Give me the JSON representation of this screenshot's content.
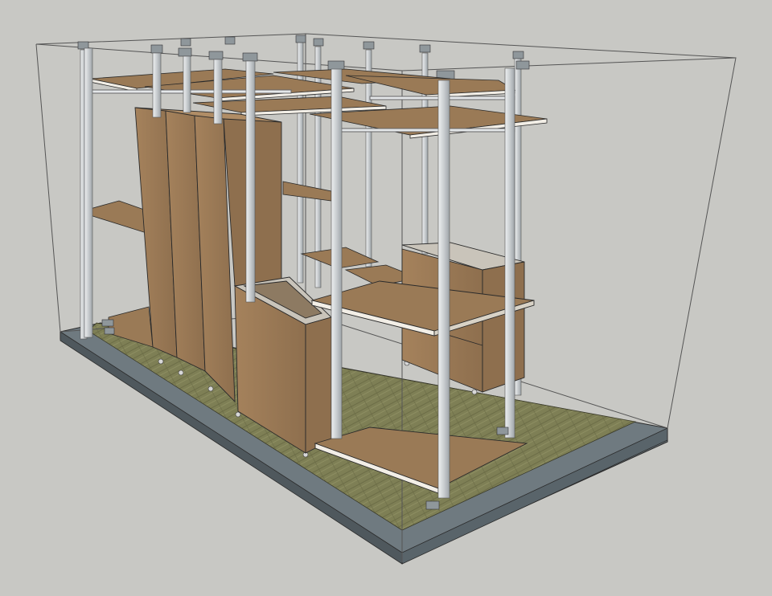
{
  "scene": {
    "subject": "",
    "colors": {
      "background": "#c8c8c4",
      "base_slab": "#6f7a80",
      "base_slab_edge": "#4f585d",
      "floor": "#7e7f55",
      "floor_dark": "#5f6140",
      "wood": "#9a7a56",
      "wood_light": "#b08d66",
      "wood_dark": "#7a5c3e",
      "shelf_edge": "#f2eee6",
      "pole": "#d6d9db",
      "pole_shade": "#9ea4a8",
      "outline": "#2a2a2a",
      "bounding_box": "#555555"
    }
  }
}
